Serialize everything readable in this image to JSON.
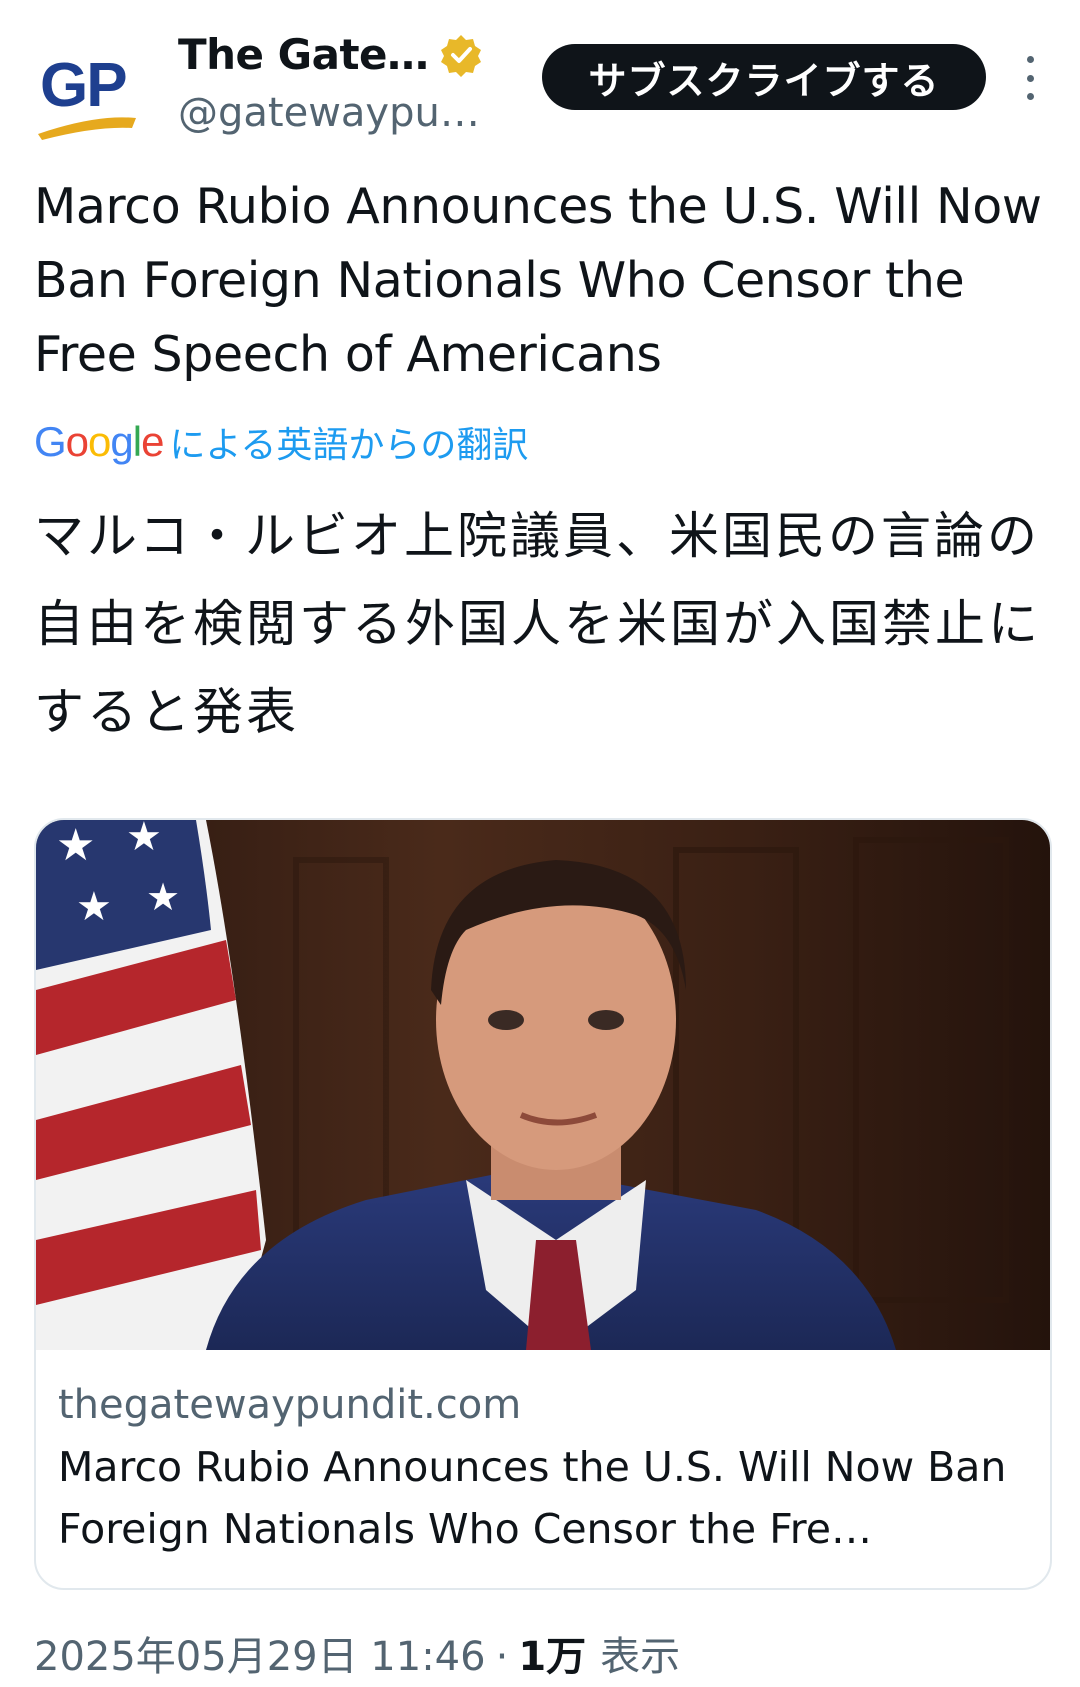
{
  "account": {
    "logo_text": "GP",
    "name": "The Gate…",
    "handle": "@gatewaypu…",
    "verified_badge_color": "#e8b829"
  },
  "subscribe_label": "サブスクライブする",
  "post": {
    "text": "Marco Rubio Announces the U.S. Will Now Ban Foreign Nationals Who Censor the Free Speech of Americans",
    "translation_label": "による英語からの翻訳",
    "translated_text": "マルコ・ルビオ上院議員、米国民の言論の自由を検閲する外国人を米国が入国禁止にすると発表"
  },
  "link_card": {
    "domain": "thegatewaypundit.com",
    "title": "Marco Rubio Announces the U.S. Will Now Ban Foreign Nationals Who Censor the Fre…"
  },
  "meta": {
    "timestamp": "2025年05月29日 11:46",
    "separator": "·",
    "views_count": "1万",
    "views_label": "表示"
  },
  "colors": {
    "accent_blue": "#1d9bf0",
    "text_primary": "#0f1419",
    "text_secondary": "#536471"
  },
  "icons": [
    "gp-logo-icon",
    "verified-badge-icon",
    "more-options-icon",
    "google-logo"
  ]
}
